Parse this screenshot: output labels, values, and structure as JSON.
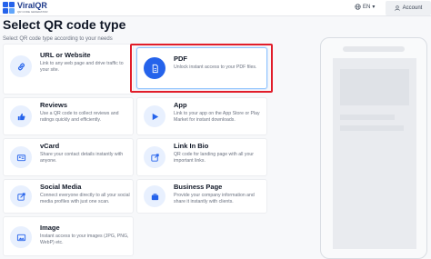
{
  "header": {
    "logo_name": "ViralQR",
    "logo_tagline": "QR CODE GENERATOR",
    "language": "EN",
    "account_label": "Account"
  },
  "page": {
    "title": "Select QR code type",
    "subtitle": "Select QR code type according to your needs"
  },
  "types": [
    {
      "title": "URL or Website",
      "desc": "Link to any web page and drive traffic to your site.",
      "icon": "link-icon"
    },
    {
      "title": "PDF",
      "desc": "Unlock instant access to your PDF files.",
      "icon": "pdf-icon",
      "selected": true
    },
    {
      "title": "Reviews",
      "desc": "Use a QR code to collect reviews and ratings quickly and efficiently.",
      "icon": "thumbs-up-icon"
    },
    {
      "title": "App",
      "desc": "Link to your app on the App Store or Play Market for instant downloads.",
      "icon": "app-icon"
    },
    {
      "title": "vCard",
      "desc": "Share your contact details instantly with anyone.",
      "icon": "contact-card-icon"
    },
    {
      "title": "Link In Bio",
      "desc": "QR code for landing page with all your important links.",
      "icon": "external-link-icon"
    },
    {
      "title": "Social Media",
      "desc": "Connect everyone directly to all your social media profiles with just one scan.",
      "icon": "share-icon"
    },
    {
      "title": "Business Page",
      "desc": "Provide your company information and share it instantly with clients.",
      "icon": "business-icon"
    },
    {
      "title": "Image",
      "desc": "Instant access to your images (JPG, PNG, WebP) etc.",
      "icon": "image-icon"
    }
  ],
  "colors": {
    "accent": "#2563eb",
    "icon_bg": "#e8f0fe",
    "highlight": "#e11d2a"
  }
}
